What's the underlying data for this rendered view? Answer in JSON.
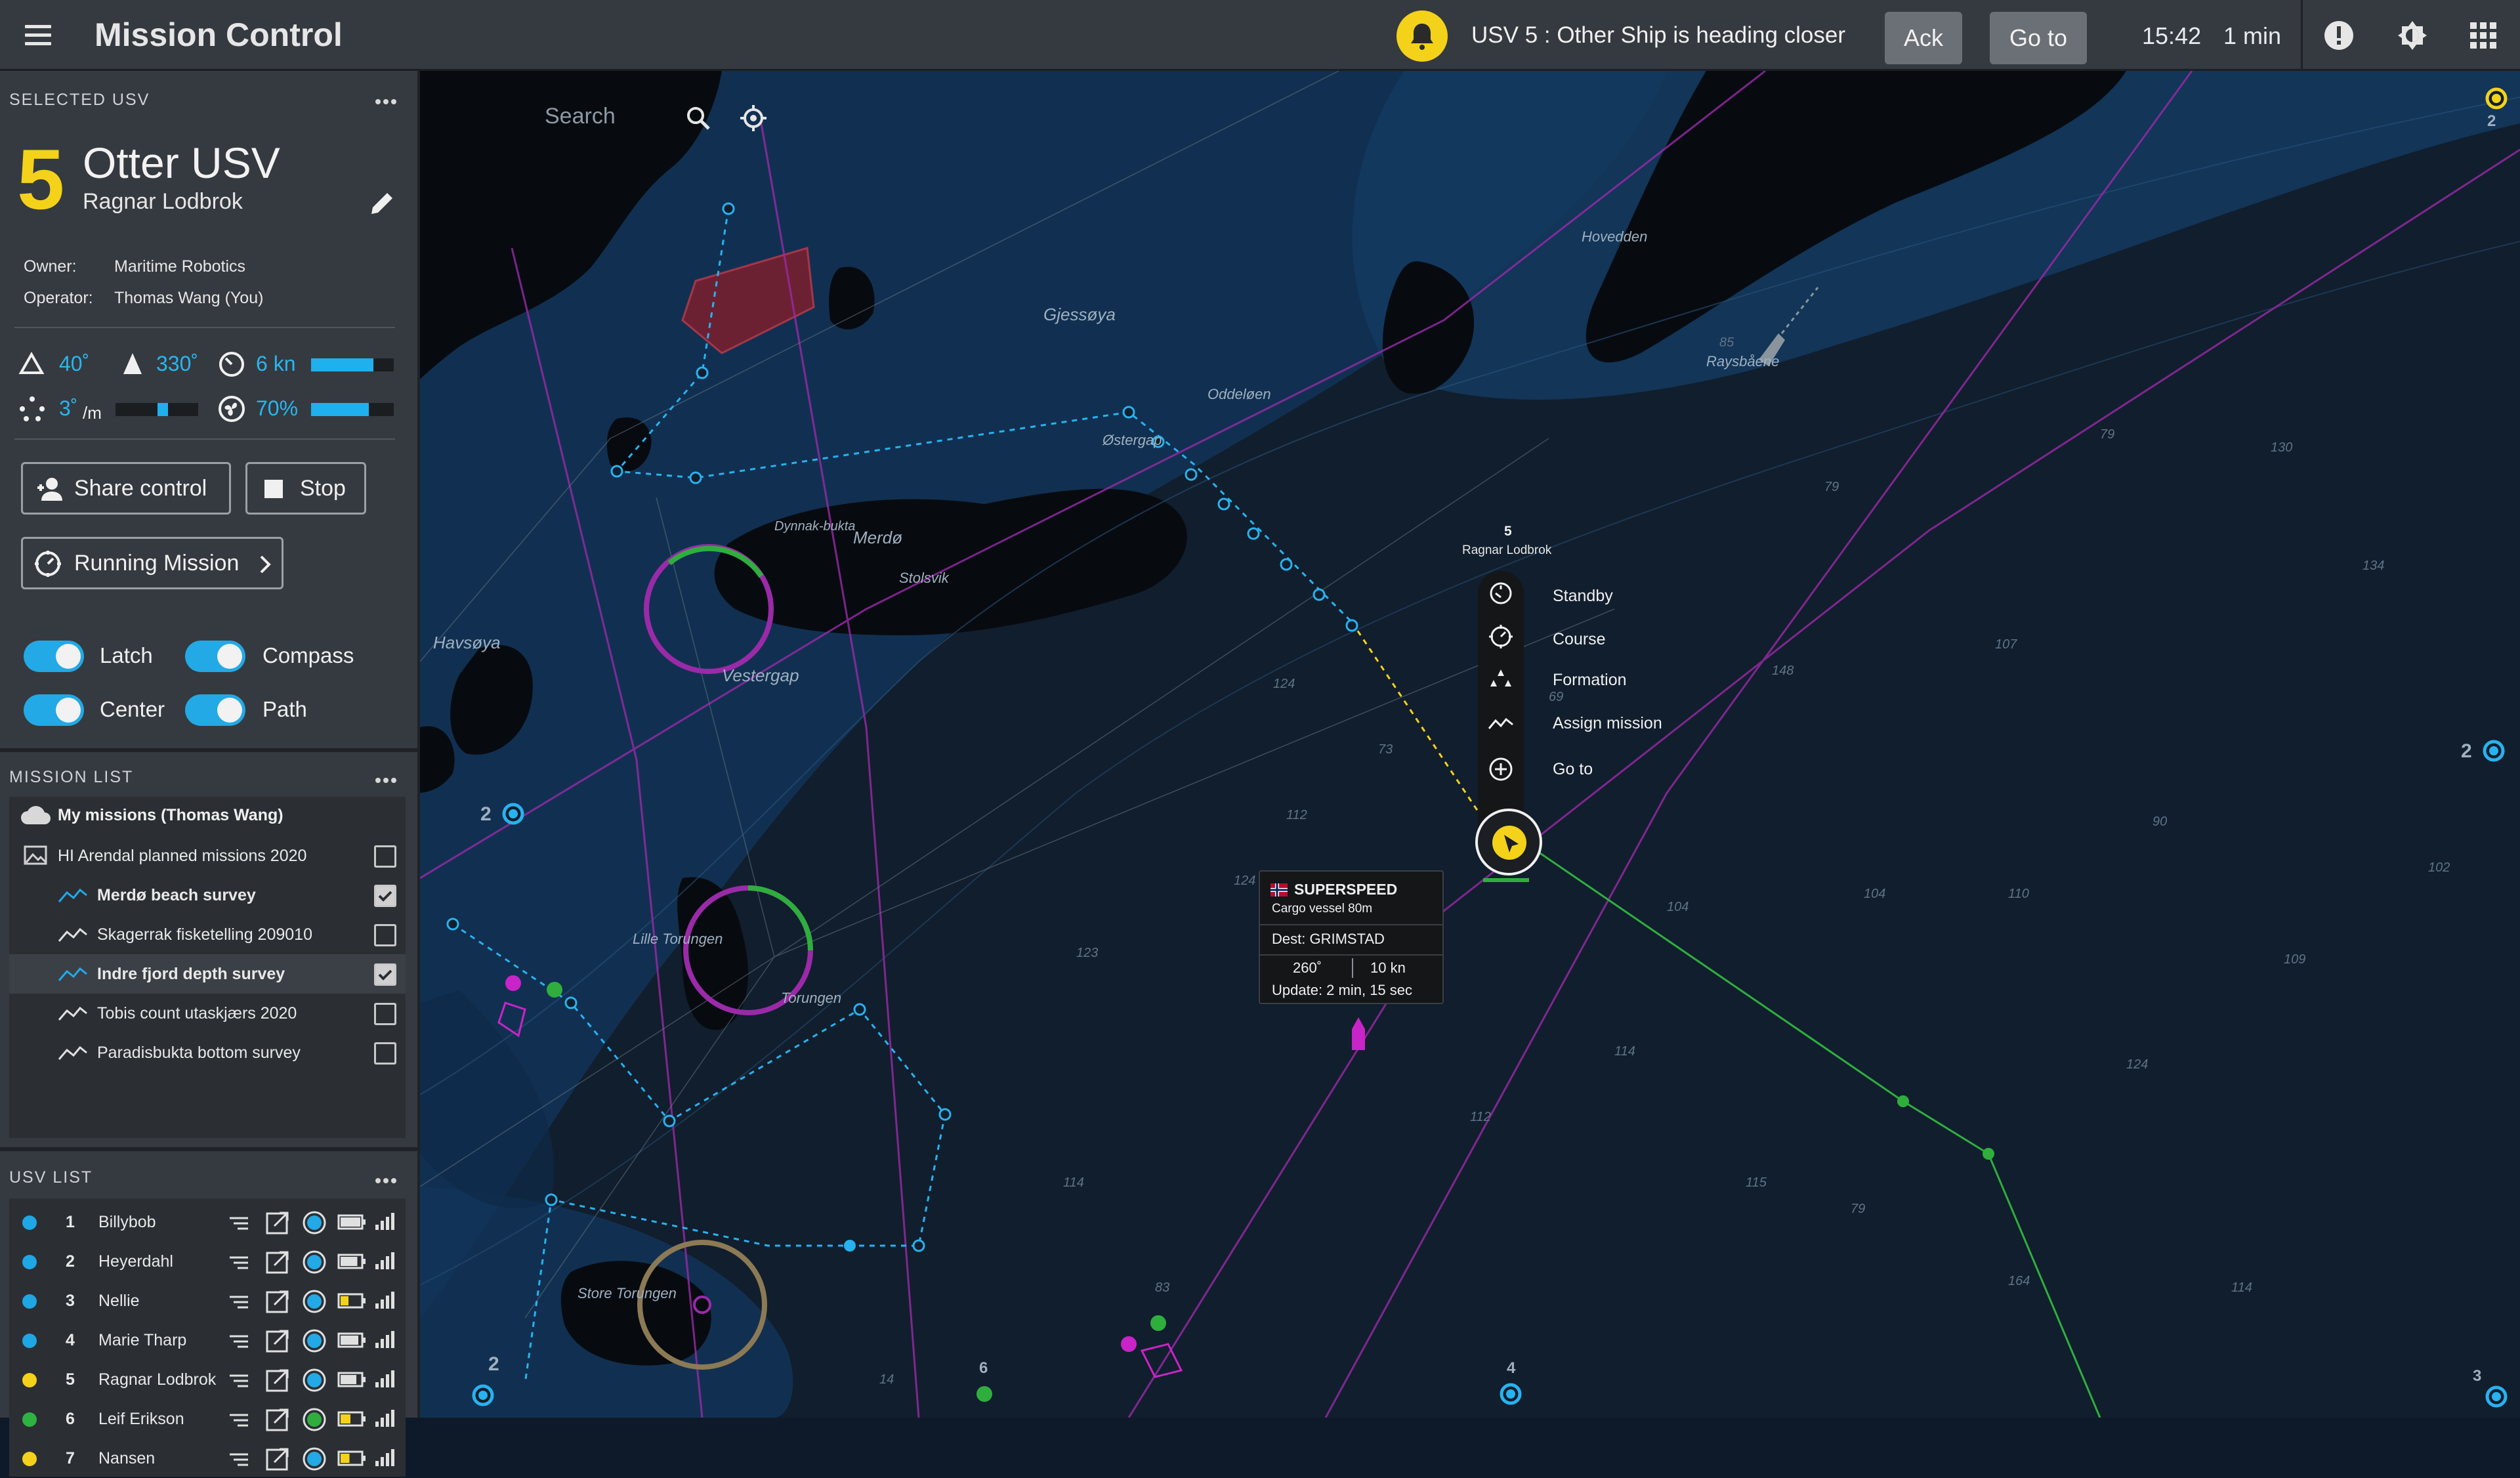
{
  "app": {
    "title": "Mission Control"
  },
  "alert": {
    "message": "USV 5 : Other Ship is heading closer",
    "ack_label": "Ack",
    "goto_label": "Go to",
    "time": "15:42",
    "elapsed": "1 min"
  },
  "selected": {
    "header": "SELECTED USV",
    "number": "5",
    "name": "Otter USV",
    "operator_name": "Ragnar Lodbrok",
    "owner_label": "Owner:",
    "owner": "Maritime Robotics",
    "operator_label": "Operator:",
    "operator": "Thomas Wang (You)",
    "telemetry": {
      "pitch": "40˚",
      "heading": "330˚",
      "speed": "6 kn",
      "speed_level": 0.75,
      "roll": "3˚",
      "roll_unit": "/m",
      "roll_level": 0.1,
      "thrust": "70%",
      "thrust_level": 0.7
    },
    "share_label": "Share control",
    "stop_label": "Stop",
    "running_label": "Running Mission",
    "toggles": [
      {
        "label": "Latch",
        "on": true
      },
      {
        "label": "Compass",
        "on": true
      },
      {
        "label": "Center",
        "on": true
      },
      {
        "label": "Path",
        "on": true
      }
    ]
  },
  "mission_list": {
    "header": "MISSION LIST",
    "group": "My missions (Thomas Wang)",
    "folder": "HI Arendal planned missions 2020",
    "items": [
      {
        "label": "Merdø beach survey",
        "checked": true,
        "active": true
      },
      {
        "label": "Skagerrak fisketelling 209010",
        "checked": false,
        "active": false
      },
      {
        "label": "Indre fjord depth survey",
        "checked": true,
        "active": true
      },
      {
        "label": "Tobis count utaskjærs 2020",
        "checked": false,
        "active": false
      },
      {
        "label": "Paradisbukta bottom survey",
        "checked": false,
        "active": false
      }
    ]
  },
  "usv_list": {
    "header": "USV LIST",
    "items": [
      {
        "num": "1",
        "name": "Billybob",
        "color": "#1ea7e4"
      },
      {
        "num": "2",
        "name": "Heyerdahl",
        "color": "#1ea7e4"
      },
      {
        "num": "3",
        "name": "Nellie",
        "color": "#1ea7e4"
      },
      {
        "num": "4",
        "name": "Marie Tharp",
        "color": "#1ea7e4"
      },
      {
        "num": "5",
        "name": "Ragnar Lodbrok",
        "color": "#f4d21a"
      },
      {
        "num": "6",
        "name": "Leif Erikson",
        "color": "#2fb340"
      },
      {
        "num": "7",
        "name": "Nansen",
        "color": "#f4d21a"
      }
    ]
  },
  "map": {
    "search_placeholder": "Search",
    "usv_marker_num": "5",
    "usv_marker_name": "Ragnar Lodbrok",
    "context_menu": [
      "Standby",
      "Course",
      "Formation",
      "Assign mission",
      "Go to"
    ],
    "ship": {
      "name": "SUPERSPEED",
      "type": "Cargo vessel 80m",
      "dest": "Dest: GRIMSTAD",
      "course": "260˚",
      "speed": "10 kn",
      "update": "Update: 2 min, 15 sec"
    },
    "cluster_labels": [
      "2",
      "2",
      "2",
      "6",
      "4",
      "3",
      "2"
    ],
    "place_names": [
      "Merdø",
      "Gjessøya",
      "Havsøya",
      "Vestergap",
      "Torungen",
      "Store Torungen",
      "Lille Torungen",
      "Østergap",
      "Oddeløen",
      "Hovedden",
      "Raysbåene",
      "Stolsvik",
      "Dynnak-bukta"
    ]
  }
}
